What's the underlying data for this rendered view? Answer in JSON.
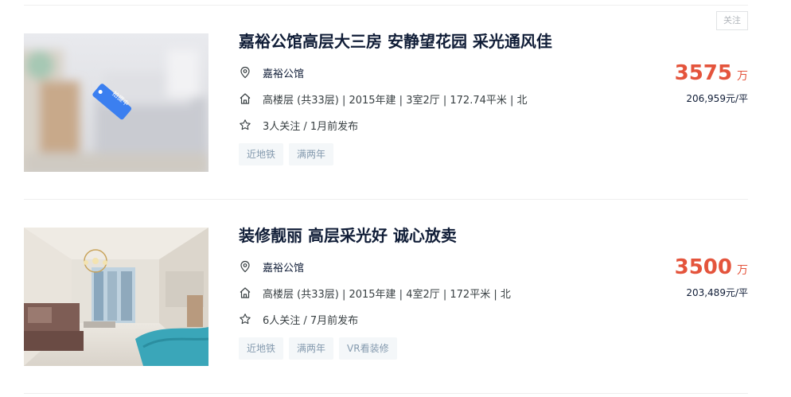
{
  "listings": [
    {
      "follow_label": "关注",
      "title": "嘉裕公馆高层大三房 安静望花园 采光通风佳",
      "community": "嘉裕公馆",
      "house_info": "高楼层 (共33层) | 2015年建 | 3室2厅 | 172.74平米 | 北",
      "follow_info": "3人关注 / 1月前发布",
      "tags": [
        "近地铁",
        "满两年"
      ],
      "total_price": "3575",
      "total_unit": "万",
      "unit_price": "206,959元/平",
      "image_badge": "拍摄中"
    },
    {
      "title": "装修靓丽 高层采光好 诚心放卖",
      "community": "嘉裕公馆",
      "house_info": "高楼层 (共33层) | 2015年建 | 4室2厅 | 172平米 | 北",
      "follow_info": "6人关注 / 7月前发布",
      "tags": [
        "近地铁",
        "满两年",
        "VR看装修"
      ],
      "total_price": "3500",
      "total_unit": "万",
      "unit_price": "203,489元/平"
    }
  ],
  "icons": {
    "location": "location-pin-icon",
    "house": "house-icon",
    "star": "star-icon"
  },
  "colors": {
    "price": "#e4543c",
    "title": "#101d37",
    "tag_bg": "#f4f7f9",
    "tag_text": "#849aae"
  }
}
